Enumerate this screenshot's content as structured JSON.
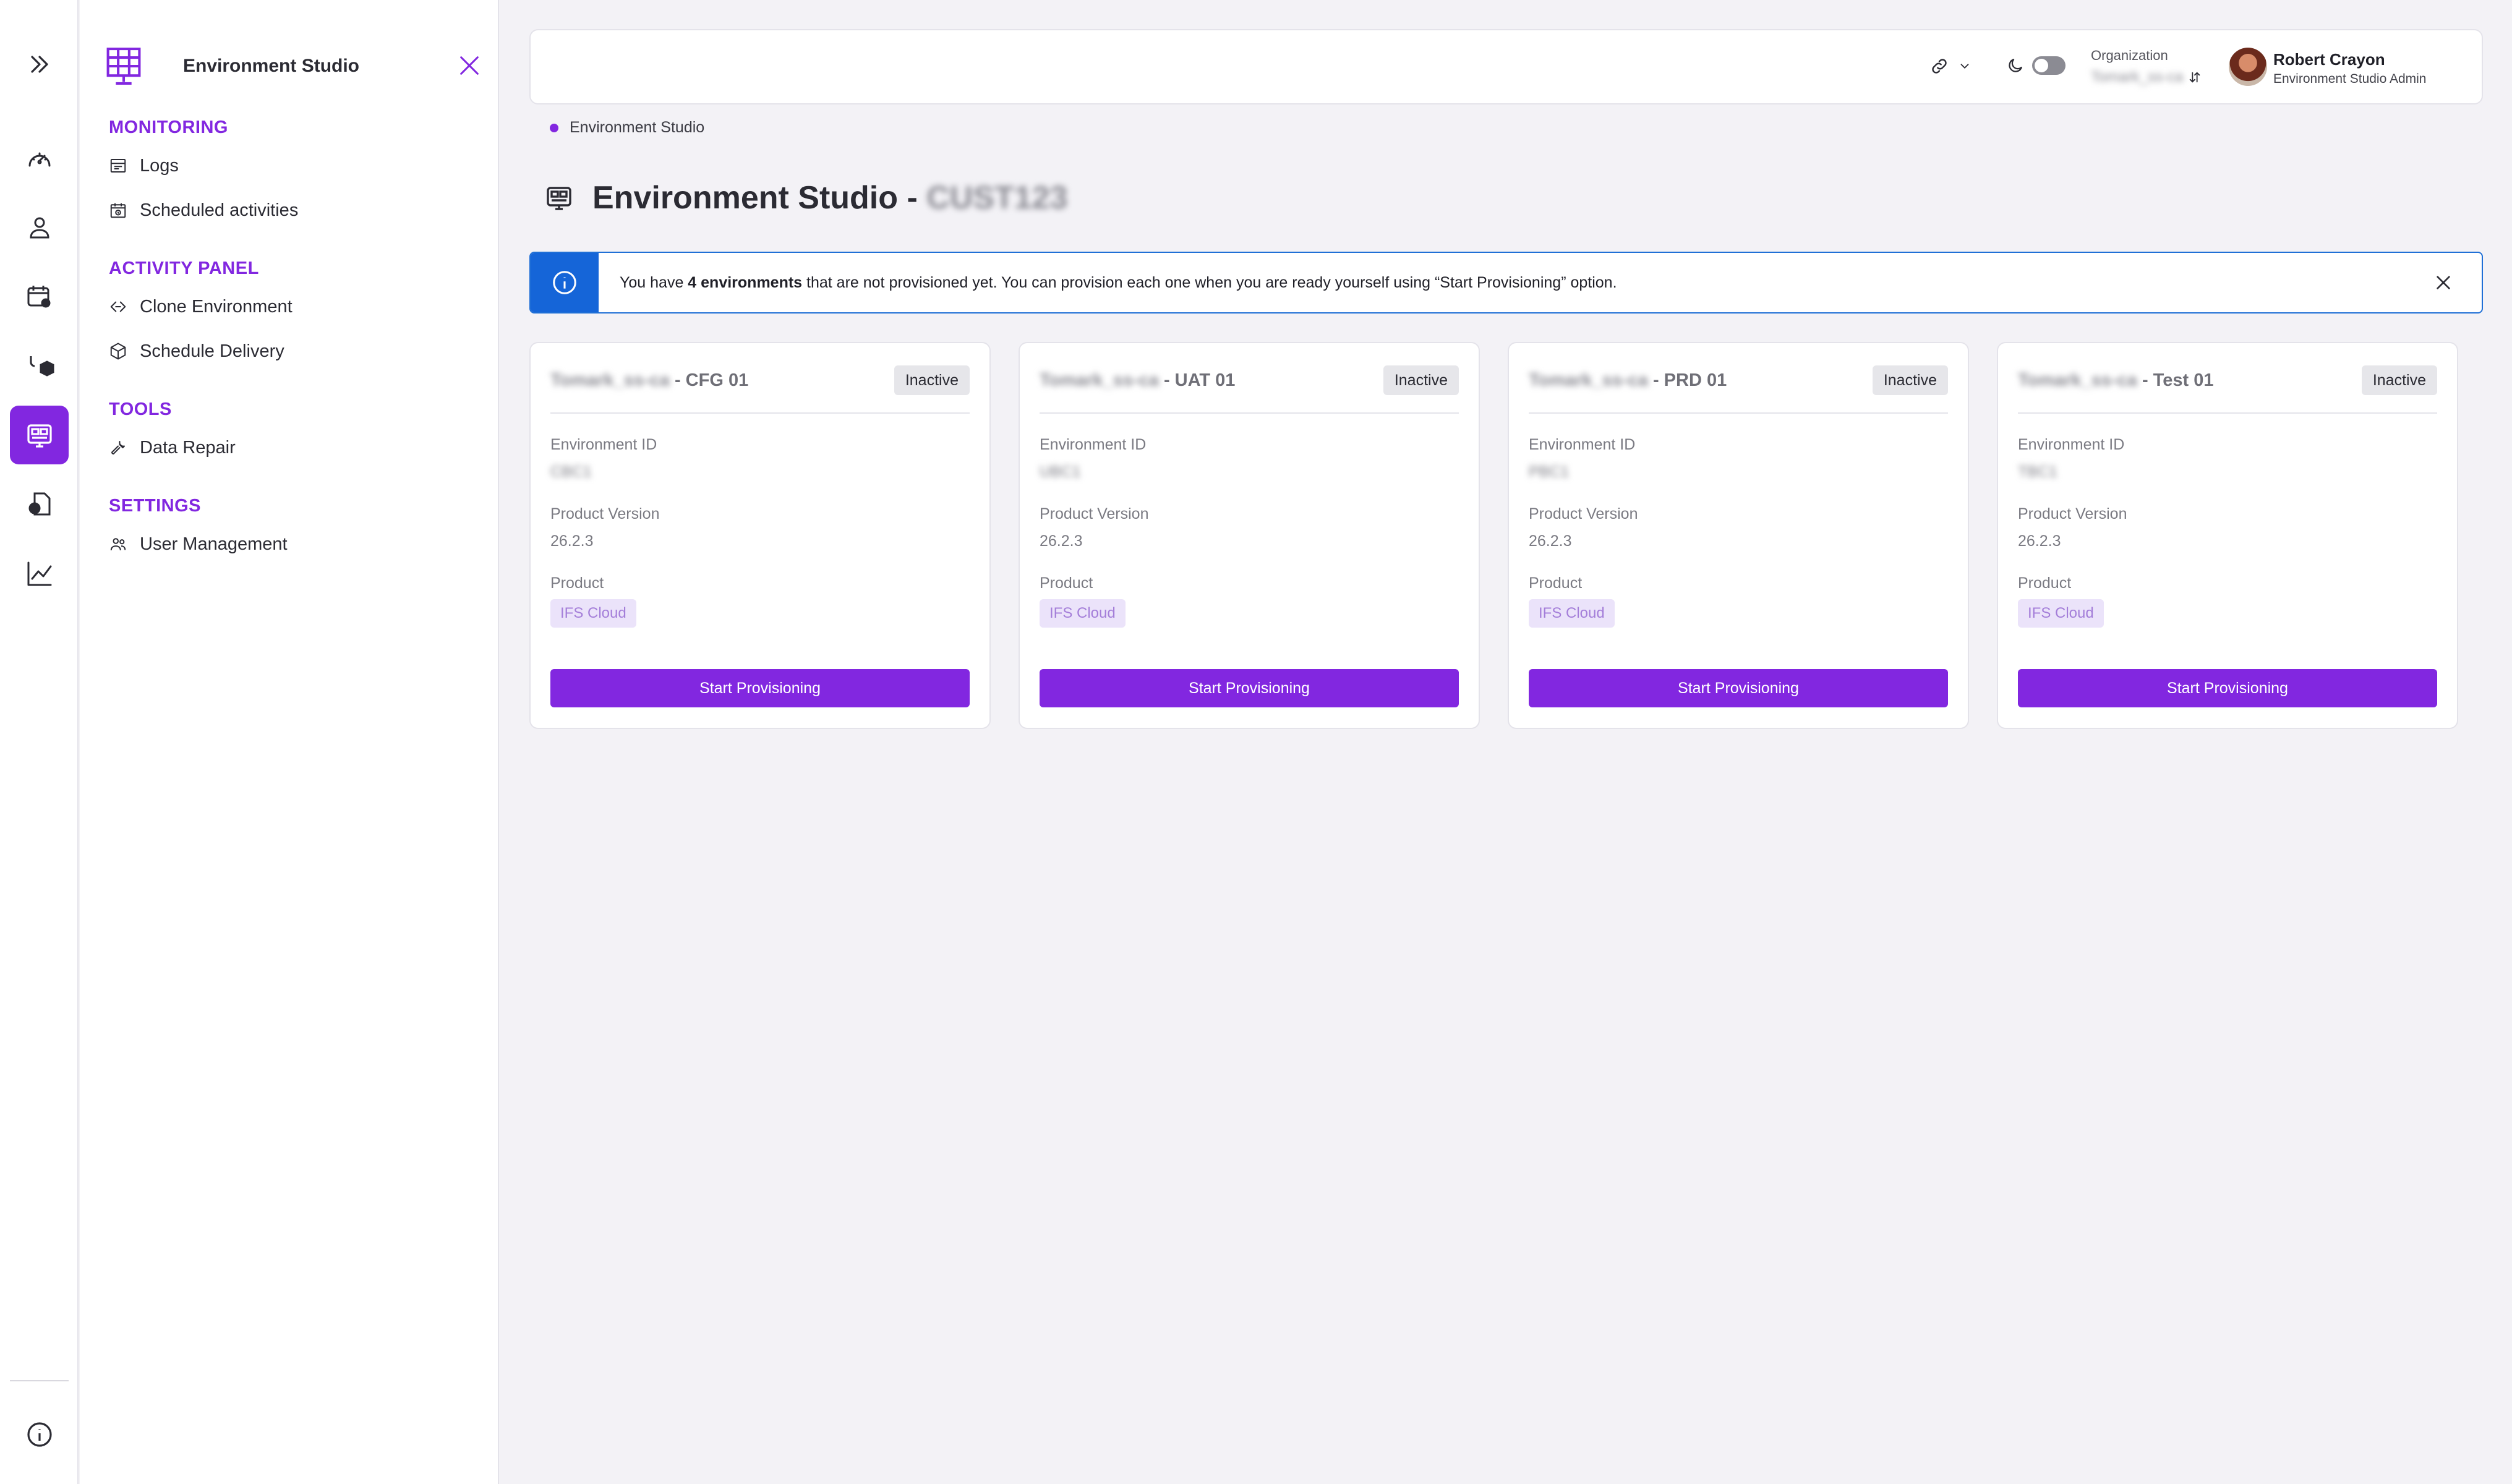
{
  "rail": {
    "items": [
      {
        "icon": "double-chevron-right-icon"
      },
      {
        "icon": "speedometer-icon"
      },
      {
        "icon": "user-icon"
      },
      {
        "icon": "calendar-gear-icon"
      },
      {
        "icon": "deploy-package-icon"
      },
      {
        "icon": "environment-grid-icon",
        "active": true
      },
      {
        "icon": "document-user-icon"
      },
      {
        "icon": "line-chart-icon"
      },
      {
        "icon": "info-icon"
      }
    ]
  },
  "panel": {
    "title": "Environment Studio",
    "sections": [
      {
        "title": "MONITORING",
        "items": [
          "Logs",
          "Scheduled activities"
        ]
      },
      {
        "title": "ACTIVITY PANEL",
        "items": [
          "Clone Environment",
          "Schedule Delivery"
        ]
      },
      {
        "title": "TOOLS",
        "items": [
          "Data Repair"
        ]
      },
      {
        "title": "SETTINGS",
        "items": [
          "User Management"
        ]
      }
    ]
  },
  "topbar": {
    "org_label": "Organization",
    "org_value": "Tomark_ss-ca",
    "user_name": "Robert Crayon",
    "user_role": "Environment Studio Admin"
  },
  "breadcrumb": {
    "current": "Environment Studio"
  },
  "page": {
    "title": "Environment Studio -",
    "title_suffix": "CUST123"
  },
  "banner": {
    "text_pre": "You have ",
    "text_bold": "4 environments",
    "text_post": " that are not provisioned yet. You can provision each one when you are ready yourself using “Start Provisioning” option."
  },
  "cards": [
    {
      "prefix": "Tomark_ss-ca",
      "name": " - CFG 01",
      "status": "Inactive",
      "env_id_label": "Environment ID",
      "env_id": "CBC1",
      "version_label": "Product Version",
      "version": "26.2.3",
      "product_label": "Product",
      "product": "IFS Cloud",
      "button": "Start Provisioning"
    },
    {
      "prefix": "Tomark_ss-ca",
      "name": " - UAT 01",
      "status": "Inactive",
      "env_id_label": "Environment ID",
      "env_id": "UBC1",
      "version_label": "Product Version",
      "version": "26.2.3",
      "product_label": "Product",
      "product": "IFS Cloud",
      "button": "Start Provisioning"
    },
    {
      "prefix": "Tomark_ss-ca",
      "name": " - PRD 01",
      "status": "Inactive",
      "env_id_label": "Environment ID",
      "env_id": "PBC1",
      "version_label": "Product Version",
      "version": "26.2.3",
      "product_label": "Product",
      "product": "IFS Cloud",
      "button": "Start Provisioning"
    },
    {
      "prefix": "Tomark_ss-ca",
      "name": " - Test 01",
      "status": "Inactive",
      "env_id_label": "Environment ID",
      "env_id": "TBC1",
      "version_label": "Product Version",
      "version": "26.2.3",
      "product_label": "Product",
      "product": "IFS Cloud",
      "button": "Start Provisioning"
    }
  ],
  "colors": {
    "accent": "#8227e0",
    "info": "#1565d8"
  }
}
